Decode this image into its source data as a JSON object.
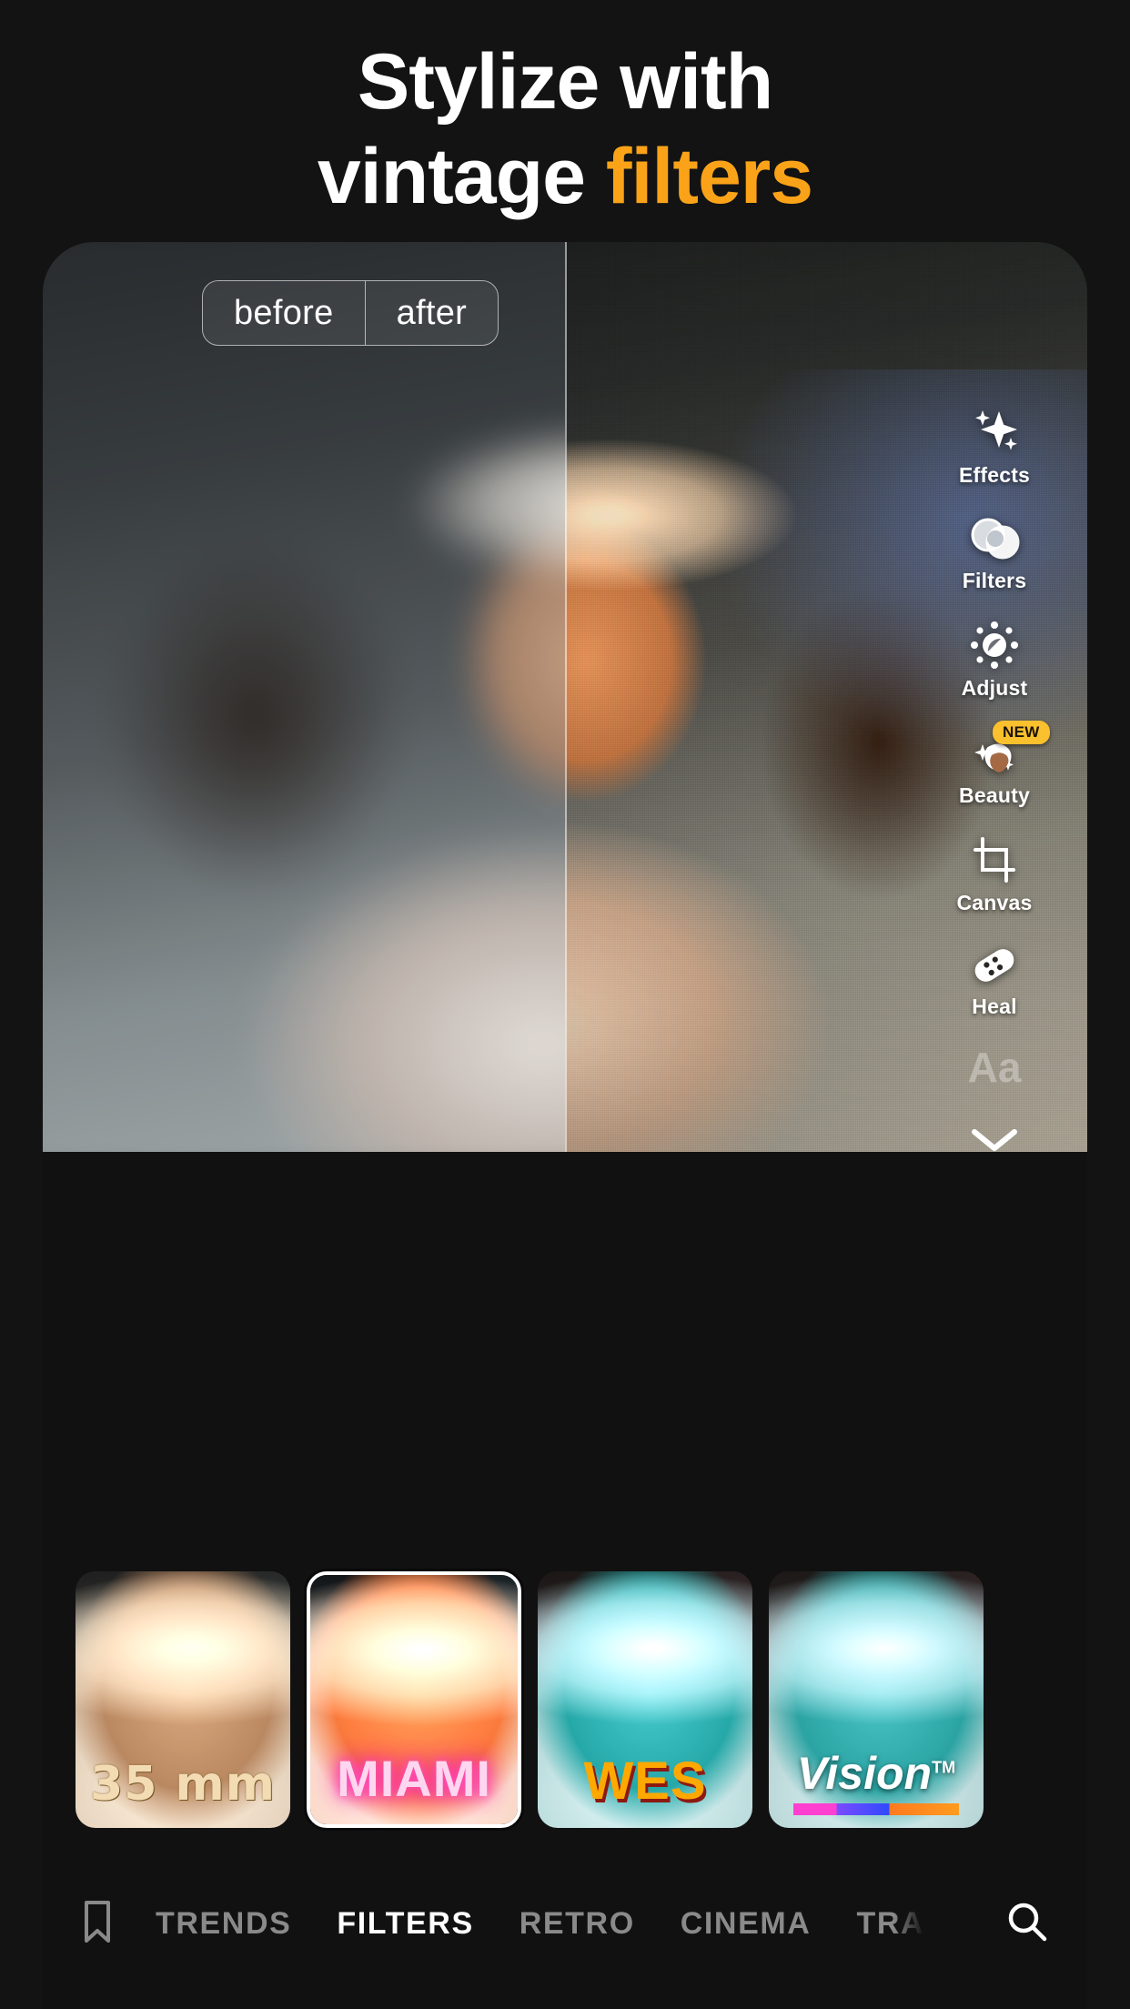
{
  "headline": {
    "line1": "Stylize with",
    "line2_plain": "vintage ",
    "line2_accent": "filters",
    "accent_color": "#FBA318",
    "text_color": "#FFFFFF",
    "background_color": "#131313"
  },
  "compare": {
    "before_label": "before",
    "after_label": "after"
  },
  "tools": [
    {
      "name": "effects",
      "label": "Effects",
      "icon": "sparkle-icon"
    },
    {
      "name": "filters",
      "label": "Filters",
      "icon": "filters-circles-icon"
    },
    {
      "name": "adjust",
      "label": "Adjust",
      "icon": "brightness-dial-icon"
    },
    {
      "name": "beauty",
      "label": "Beauty",
      "icon": "beauty-face-icon",
      "badge": "NEW",
      "badge_color": "#FBC02D"
    },
    {
      "name": "canvas",
      "label": "Canvas",
      "icon": "crop-icon"
    },
    {
      "name": "heal",
      "label": "Heal",
      "icon": "bandage-icon"
    },
    {
      "name": "text",
      "label": "Aa",
      "icon": "text-aa-icon",
      "faded": true
    }
  ],
  "expand_icon": "chevron-down-icon",
  "filters": [
    {
      "id": "35mm",
      "label": "35 mm",
      "selected": false
    },
    {
      "id": "miami",
      "label": "MIAMI",
      "selected": true
    },
    {
      "id": "wes",
      "label": "WES",
      "selected": false
    },
    {
      "id": "vision",
      "label": "Vision",
      "trademark": "TM",
      "selected": false
    }
  ],
  "tabbar": {
    "bookmark_icon": "bookmark-icon",
    "search_icon": "search-icon",
    "tabs": [
      {
        "label": "TRENDS",
        "active": false
      },
      {
        "label": "FILTERS",
        "active": true
      },
      {
        "label": "RETRO",
        "active": false
      },
      {
        "label": "CINEMA",
        "active": false
      },
      {
        "label": "TRA",
        "active": false,
        "truncated": true
      }
    ]
  }
}
